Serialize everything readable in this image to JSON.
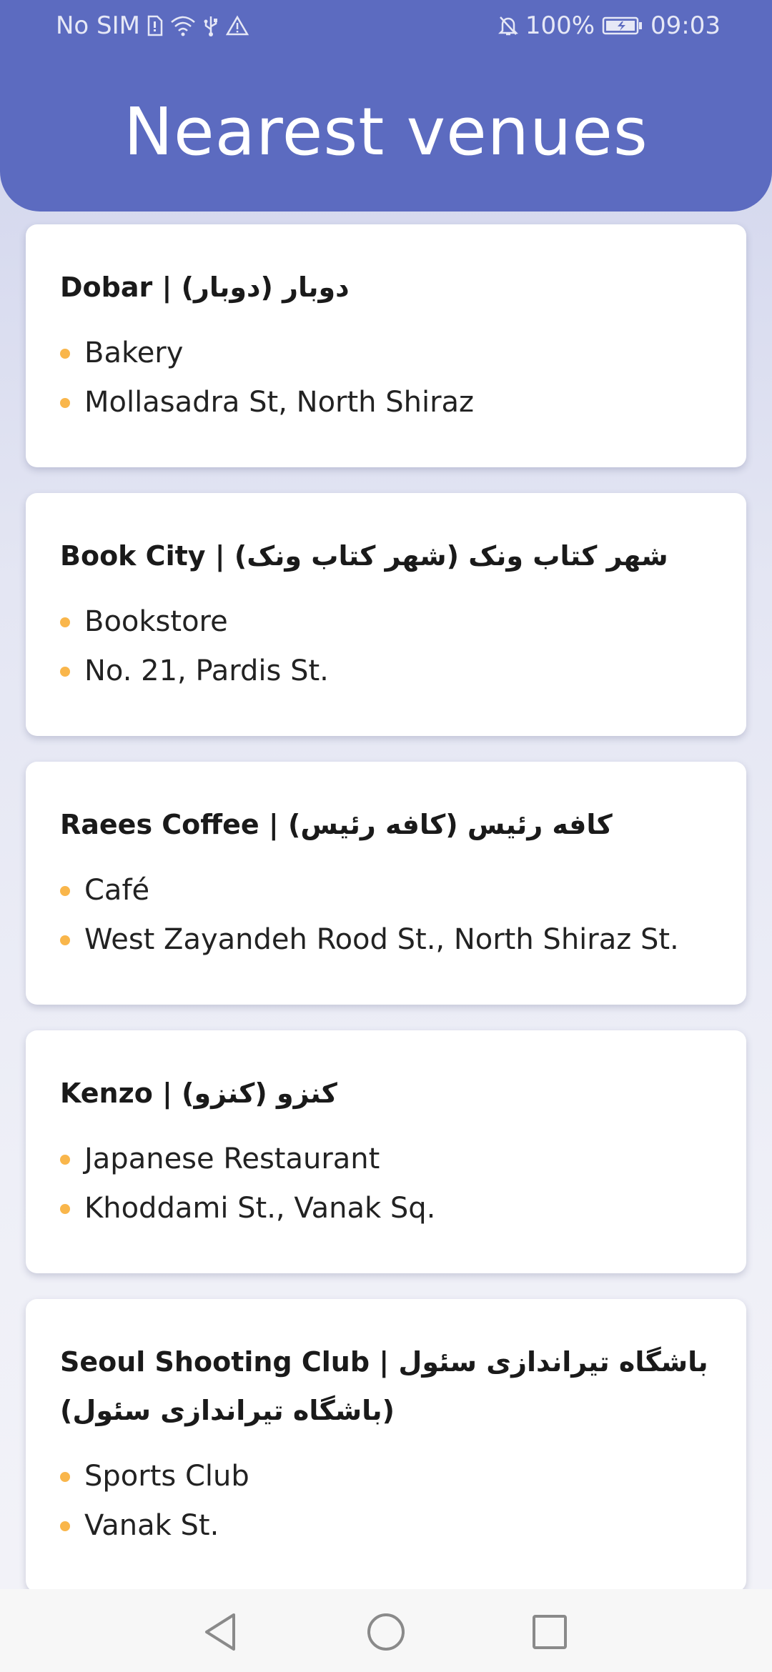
{
  "status_bar": {
    "carrier": "No SIM",
    "battery": "100%",
    "time": "09:03"
  },
  "header": {
    "title": "Nearest venues"
  },
  "venues": [
    {
      "name": "Dobar | دوبار (دوبار)",
      "category": "Bakery",
      "address": "Mollasadra St, North Shiraz"
    },
    {
      "name": "Book City | شهر کتاب ونک (شهر کتاب ونک)",
      "category": "Bookstore",
      "address": "No. 21, Pardis St."
    },
    {
      "name": "Raees Coffee | کافه رئیس (کافه رئیس)",
      "category": "Café",
      "address": "West Zayandeh Rood St., North Shiraz St."
    },
    {
      "name": "Kenzo | کنزو (کنزو)",
      "category": "Japanese Restaurant",
      "address": "Khoddami St., Vanak Sq."
    },
    {
      "name": "Seoul Shooting Club | باشگاه تیراندازی سئول (باشگاه تیراندازی سئول)",
      "category": "Sports Club",
      "address": "Vanak St."
    }
  ],
  "colors": {
    "header": "#5c6bc0",
    "bullet": "#f9b64b"
  },
  "icons": {
    "back": "back-triangle-icon",
    "home": "home-circle-icon",
    "recents": "recents-square-icon"
  }
}
